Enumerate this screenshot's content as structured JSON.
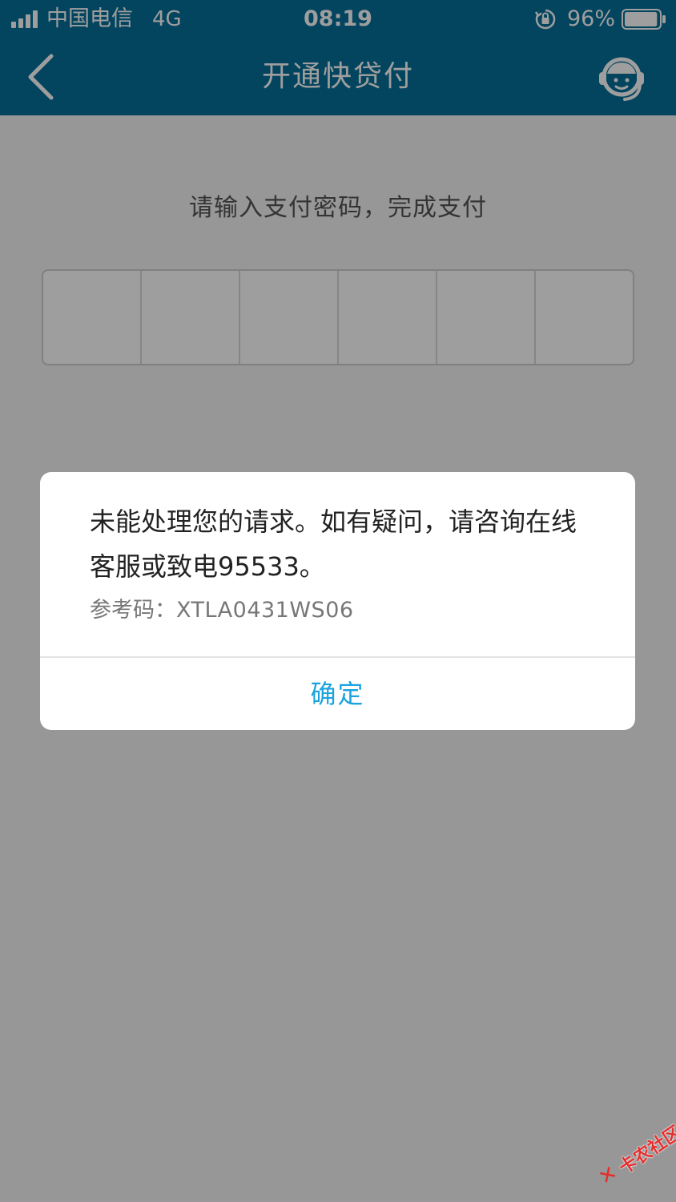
{
  "status_bar": {
    "carrier": "中国电信",
    "network": "4G",
    "time": "08:19",
    "battery_percent": "96%",
    "battery_level": 0.96,
    "icons": [
      "signal-icon",
      "orientation-lock-icon",
      "battery-icon"
    ]
  },
  "nav": {
    "title": "开通快贷付",
    "back_icon": "chevron-left-icon",
    "service_icon": "customer-service-icon"
  },
  "page": {
    "prompt": "请输入支付密码，完成支付",
    "pin_length": 6
  },
  "dialog": {
    "message": "未能处理您的请求。如有疑问，请咨询在线客服或致电95533。",
    "ref_label": "参考码：",
    "ref_code": "XTLA0431WS06",
    "confirm_label": "确定"
  },
  "watermark": {
    "text": "卡农社区"
  },
  "colors": {
    "header": "#06709a",
    "confirm": "#1aa3de",
    "watermark": "#e52f2f"
  }
}
